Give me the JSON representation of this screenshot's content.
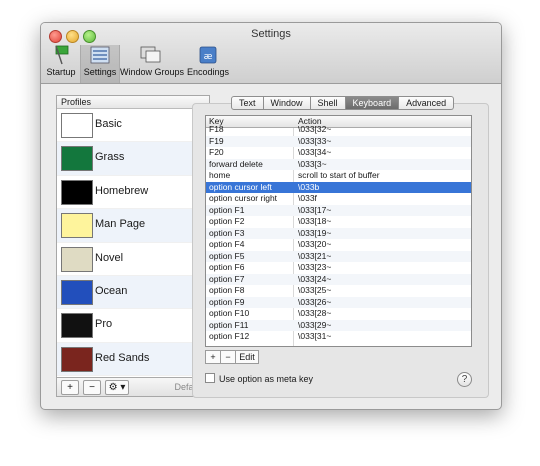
{
  "window": {
    "title": "Settings"
  },
  "toolbar": {
    "items": [
      {
        "label": "Startup",
        "icon": "startup-icon"
      },
      {
        "label": "Settings",
        "icon": "settings-icon",
        "selected": true
      },
      {
        "label": "Window Groups",
        "icon": "window-groups-icon"
      },
      {
        "label": "Encodings",
        "icon": "encodings-icon"
      }
    ]
  },
  "profiles": {
    "header": "Profiles",
    "items": [
      {
        "label": "Basic",
        "thumb": "#ffffff"
      },
      {
        "label": "Grass",
        "thumb": "#13773d"
      },
      {
        "label": "Homebrew",
        "thumb": "#000000"
      },
      {
        "label": "Man Page",
        "thumb": "#fef49c"
      },
      {
        "label": "Novel",
        "thumb": "#dfdbc3"
      },
      {
        "label": "Ocean",
        "thumb": "#224fbc"
      },
      {
        "label": "Pro",
        "thumb": "#111111"
      },
      {
        "label": "Red Sands",
        "thumb": "#7a251e"
      }
    ],
    "footer": {
      "add": "+",
      "remove": "−",
      "gear": "⚙ ▾",
      "default": "Default"
    }
  },
  "tabs": [
    {
      "label": "Text"
    },
    {
      "label": "Window"
    },
    {
      "label": "Shell"
    },
    {
      "label": "Keyboard",
      "active": true
    },
    {
      "label": "Advanced"
    }
  ],
  "keyboard": {
    "columns": {
      "key": "Key",
      "action": "Action"
    },
    "rows": [
      {
        "key": "F18",
        "action": "\\033[32~"
      },
      {
        "key": "F19",
        "action": "\\033[33~"
      },
      {
        "key": "F20",
        "action": "\\033[34~"
      },
      {
        "key": "forward delete",
        "action": "\\033[3~"
      },
      {
        "key": "home",
        "action": "scroll to start of buffer"
      },
      {
        "key": "option cursor left",
        "action": "\\033b",
        "selected": true
      },
      {
        "key": "option cursor right",
        "action": "\\033f"
      },
      {
        "key": "option F1",
        "action": "\\033[17~"
      },
      {
        "key": "option F2",
        "action": "\\033[18~"
      },
      {
        "key": "option F3",
        "action": "\\033[19~"
      },
      {
        "key": "option F4",
        "action": "\\033[20~"
      },
      {
        "key": "option F5",
        "action": "\\033[21~"
      },
      {
        "key": "option F6",
        "action": "\\033[23~"
      },
      {
        "key": "option F7",
        "action": "\\033[24~"
      },
      {
        "key": "option F8",
        "action": "\\033[25~"
      },
      {
        "key": "option F9",
        "action": "\\033[26~"
      },
      {
        "key": "option F10",
        "action": "\\033[28~"
      },
      {
        "key": "option F11",
        "action": "\\033[29~"
      },
      {
        "key": "option F12",
        "action": "\\033[31~"
      }
    ],
    "buttons": {
      "add": "+",
      "remove": "−",
      "edit": "Edit"
    },
    "meta_key_label": "Use option as meta key",
    "help": "?"
  }
}
